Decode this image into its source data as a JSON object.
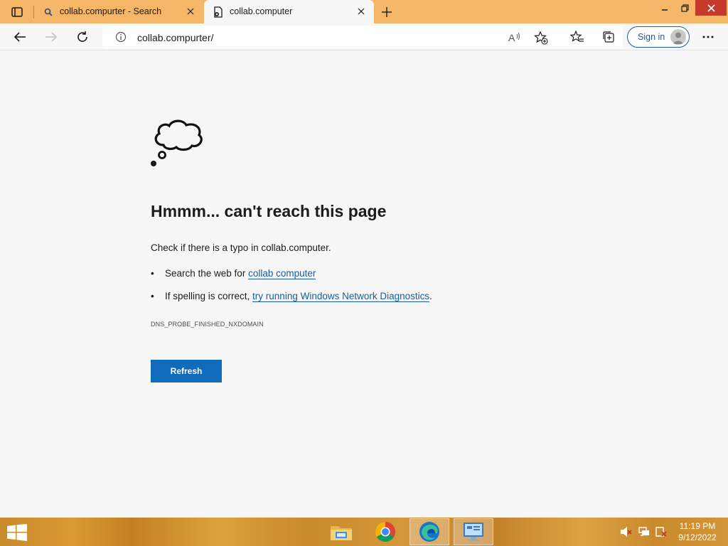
{
  "browser": {
    "tabs": [
      {
        "title": "collab.compurter - Search",
        "icon": "search-icon",
        "active": false
      },
      {
        "title": "collab.computer",
        "icon": "page-error-icon",
        "active": true
      }
    ],
    "address_url": "collab.compurter/",
    "signin_label": "Sign in"
  },
  "error_page": {
    "title": "Hmmm... can't reach this page",
    "check_text": "Check if there is a typo in collab.computer.",
    "bullets": [
      {
        "prefix": "Search the web for ",
        "link": "collab computer",
        "suffix": ""
      },
      {
        "prefix": "If spelling is correct, ",
        "link": "try running Windows Network Diagnostics",
        "suffix": "."
      }
    ],
    "error_code": "DNS_PROBE_FINISHED_NXDOMAIN",
    "refresh_label": "Refresh"
  },
  "taskbar": {
    "apps": [
      "file-explorer-icon",
      "chrome-icon",
      "edge-icon",
      "control-panel-icon"
    ],
    "time": "11:19 PM",
    "date": "9/12/2022"
  },
  "colors": {
    "title_bar": "#f5b668",
    "accent": "#0f6cbd",
    "link": "#1a5d9e",
    "close_button": "#c7392c"
  }
}
